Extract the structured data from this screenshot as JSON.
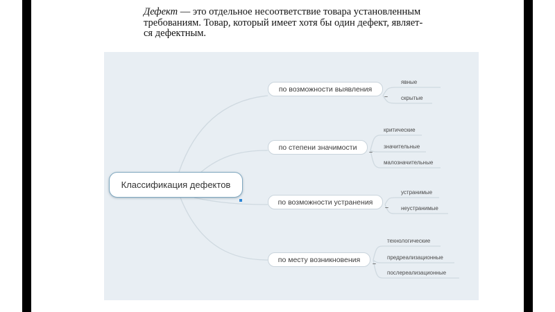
{
  "definition": {
    "term": "Дефект",
    "line1_rest": " — это отдельное несоответствие товара установленным",
    "line2": "требованиям. Товар, который имеет хотя бы один дефект, являет-",
    "line3": "ся дефектным."
  },
  "mindmap": {
    "root": "Классификация дефектов",
    "collapse_symbol": "–",
    "branches": [
      {
        "label": "по возможности выявления",
        "leaves": [
          "явные",
          "скрытые"
        ]
      },
      {
        "label": "по степени значимости",
        "leaves": [
          "критические",
          "значительные",
          "малозначительные"
        ]
      },
      {
        "label": "по возможности устранения",
        "leaves": [
          "устранимые",
          "неустранимые"
        ]
      },
      {
        "label": "по месту возникновения",
        "leaves": [
          "технологические",
          "предреализационные",
          "послереализационные"
        ]
      }
    ]
  },
  "colors": {
    "canvas": "#e8eef3",
    "connector": "#cfd9e0",
    "root_border": "#7fa7bf",
    "selection_marker": "#2e86d6"
  }
}
